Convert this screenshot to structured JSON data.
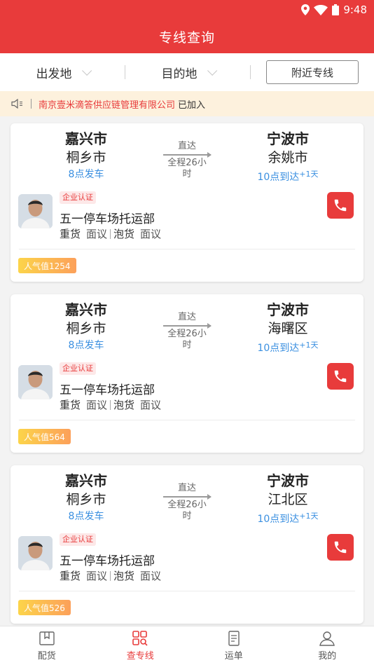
{
  "status_bar": {
    "time": "9:48"
  },
  "header": {
    "title": "专线查询"
  },
  "filters": {
    "from": "出发地",
    "to": "目的地",
    "nearby": "附近专线"
  },
  "notice": {
    "company": "南京壹米滴答供应链管理有限公司",
    "suffix": "已加入"
  },
  "cards": [
    {
      "from_city": "嘉兴市",
      "from_district": "桐乡市",
      "depart": "8点发车",
      "direct": "直达",
      "duration": "全程26小时",
      "to_city": "宁波市",
      "to_district": "余姚市",
      "arrive": "10点到达",
      "arrive_sup": "+1天",
      "badge": "企业认证",
      "company": "五一停车场托运部",
      "heavy": "重货",
      "heavy_val": "面议",
      "light": "泡货",
      "light_val": "面议",
      "popularity": "人气值1254"
    },
    {
      "from_city": "嘉兴市",
      "from_district": "桐乡市",
      "depart": "8点发车",
      "direct": "直达",
      "duration": "全程26小时",
      "to_city": "宁波市",
      "to_district": "海曙区",
      "arrive": "10点到达",
      "arrive_sup": "+1天",
      "badge": "企业认证",
      "company": "五一停车场托运部",
      "heavy": "重货",
      "heavy_val": "面议",
      "light": "泡货",
      "light_val": "面议",
      "popularity": "人气值564"
    },
    {
      "from_city": "嘉兴市",
      "from_district": "桐乡市",
      "depart": "8点发车",
      "direct": "直达",
      "duration": "全程26小时",
      "to_city": "宁波市",
      "to_district": "江北区",
      "arrive": "10点到达",
      "arrive_sup": "+1天",
      "badge": "企业认证",
      "company": "五一停车场托运部",
      "heavy": "重货",
      "heavy_val": "面议",
      "light": "泡货",
      "light_val": "面议",
      "popularity": "人气值526"
    }
  ],
  "tabs": [
    {
      "label": "配货",
      "icon": "map-icon"
    },
    {
      "label": "查专线",
      "icon": "grid-search-icon",
      "active": true
    },
    {
      "label": "运单",
      "icon": "document-icon"
    },
    {
      "label": "我的",
      "icon": "user-icon"
    }
  ],
  "colors": {
    "accent": "#e83b3b",
    "link": "#3a8fe0",
    "notice_bg": "#fdf1dd"
  }
}
